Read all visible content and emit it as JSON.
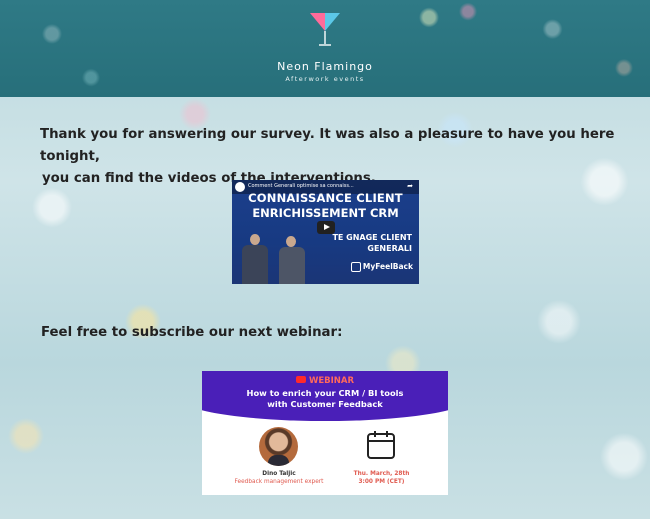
{
  "header": {
    "brand_name": "Neon Flamingo",
    "brand_tagline": "Afterwork events",
    "icon": "cocktail-glass-icon",
    "colors": {
      "band": "#2f7a86",
      "glass_left": "#ff6b9a",
      "glass_right": "#5bc8e8"
    }
  },
  "main": {
    "thanks_line1": "Thank you for answering our survey. It was also a pleasure to have you here tonight,",
    "thanks_line2": "you can find the videos of the interventions.",
    "subscribe_text": "Feel free to subscribe our next webinar:"
  },
  "video": {
    "title": "Comment Generali optimise sa connaiss...",
    "headline1": "CONNAISSANCE CLIENT",
    "headline2": "ENRICHISSEMENT CRM",
    "testimonial1": "TE   GNAGE CLIENT",
    "testimonial2": "GENERALI",
    "brand": "MyFeelBack",
    "icons": [
      "channel-avatar-icon",
      "share-icon",
      "play-button-icon"
    ]
  },
  "webinar": {
    "label": "WEBINAR",
    "title1": "How to enrich your CRM / BI tools",
    "title2": "with Customer Feedback",
    "speaker_name": "Dino Taljic",
    "speaker_role": "Feedback management expert",
    "date": "Thu. March, 28th",
    "time": "3:00 PM (CET)",
    "colors": {
      "band": "#4a1fb8",
      "accent": "#ff6a5b"
    },
    "icons": [
      "youtube-icon",
      "calendar-icon",
      "speaker-avatar"
    ]
  }
}
